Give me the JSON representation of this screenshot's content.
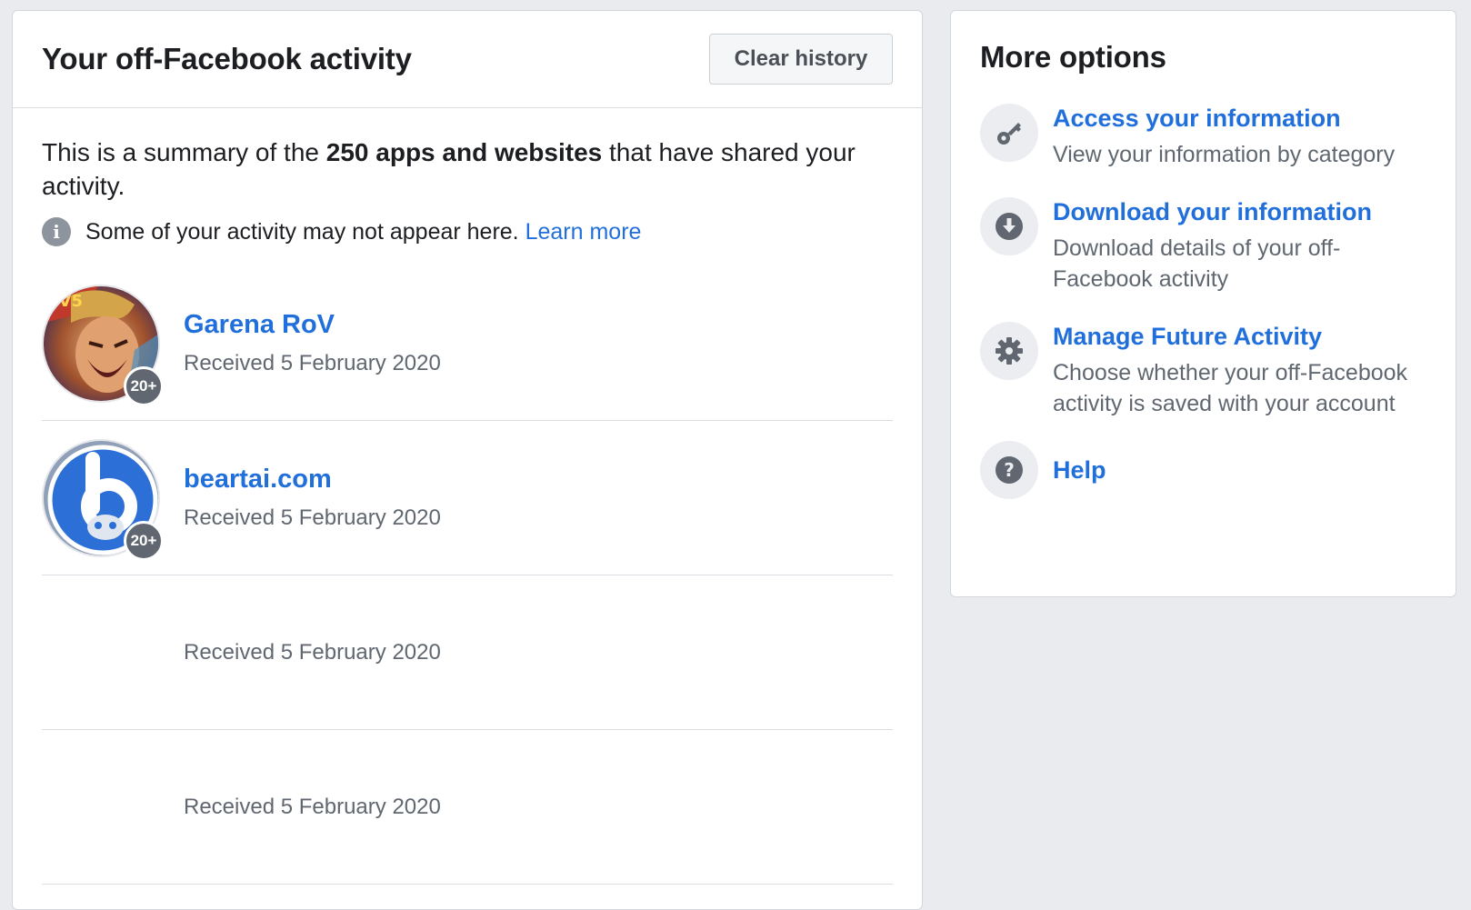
{
  "main": {
    "title": "Your off-Facebook activity",
    "clear_label": "Clear history",
    "summary_prefix": "This is a summary of the ",
    "summary_bold": "250 apps and websites",
    "summary_suffix": " that have shared your activity.",
    "notice_text": "Some of your activity may not appear here. ",
    "notice_link": "Learn more",
    "items": [
      {
        "name": "Garena RoV",
        "date": "Received 5 February 2020",
        "badge": "20+"
      },
      {
        "name": "beartai.com",
        "date": "Received 5 February 2020",
        "badge": "20+"
      },
      {
        "name": "",
        "date": "Received 5 February 2020",
        "badge": ""
      },
      {
        "name": "",
        "date": "Received 5 February 2020",
        "badge": ""
      }
    ]
  },
  "side": {
    "title": "More options",
    "options": [
      {
        "icon": "key-icon",
        "title": "Access your information",
        "desc": "View your information by category"
      },
      {
        "icon": "download-icon",
        "title": "Download your information",
        "desc": "Download details of your off-Facebook activity"
      },
      {
        "icon": "gear-icon",
        "title": "Manage Future Activity",
        "desc": "Choose whether your off-Facebook activity is saved with your account"
      },
      {
        "icon": "help-icon",
        "title": "Help",
        "desc": ""
      }
    ]
  },
  "colors": {
    "link": "#216fdb",
    "background": "#e9ebee",
    "badge": "#606770"
  }
}
